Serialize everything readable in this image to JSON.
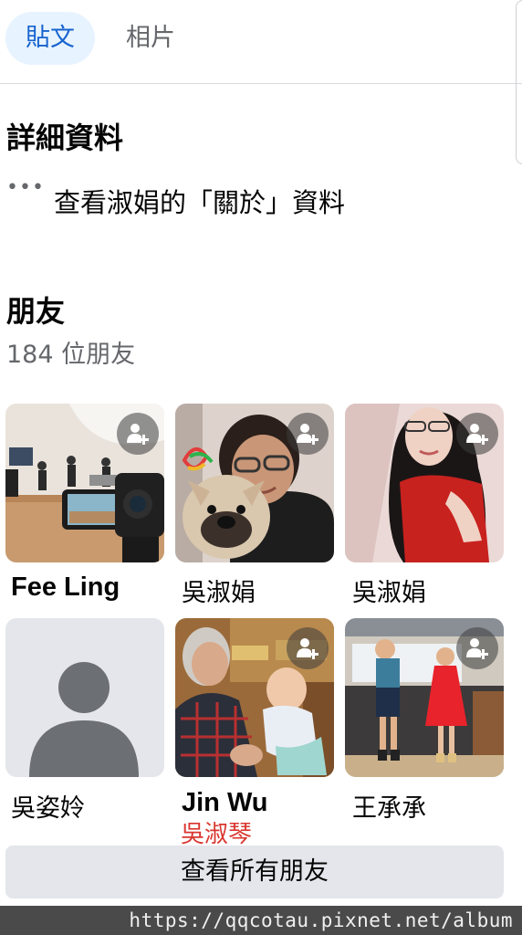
{
  "tabs": [
    {
      "label": "貼文",
      "active": true
    },
    {
      "label": "相片",
      "active": false
    }
  ],
  "details": {
    "title": "詳細資料",
    "dots_icon": "more-dots-icon",
    "about_link": "查看淑娟的「關於」資料"
  },
  "friends": {
    "title": "朋友",
    "count_text": "184 位朋友",
    "items": [
      {
        "name": "Fee Ling",
        "subname": "",
        "photo": "studio-camera-photo",
        "has_add_button": true
      },
      {
        "name": "吳淑娟",
        "subname": "",
        "photo": "woman-with-bulldog-photo",
        "has_add_button": true
      },
      {
        "name": "吳淑娟",
        "subname": "",
        "photo": "woman-long-hair-photo",
        "has_add_button": true
      },
      {
        "name": "吳姿姈",
        "subname": "",
        "photo": "default-avatar",
        "has_add_button": false
      },
      {
        "name": "Jin Wu",
        "subname": "吳淑琴",
        "photo": "grandmother-with-baby-photo",
        "has_add_button": true
      },
      {
        "name": "王承承",
        "subname": "",
        "photo": "two-children-photo",
        "has_add_button": true
      }
    ],
    "see_all_label": "查看所有朋友"
  },
  "watermark": "https://qqcotau.pixnet.net/album",
  "colors": {
    "accent": "#1763cf",
    "accent_bg": "#e7f3ff",
    "secondary_text": "#65676b",
    "button_bg": "#e4e6eb",
    "subname_red": "#d9362f"
  }
}
